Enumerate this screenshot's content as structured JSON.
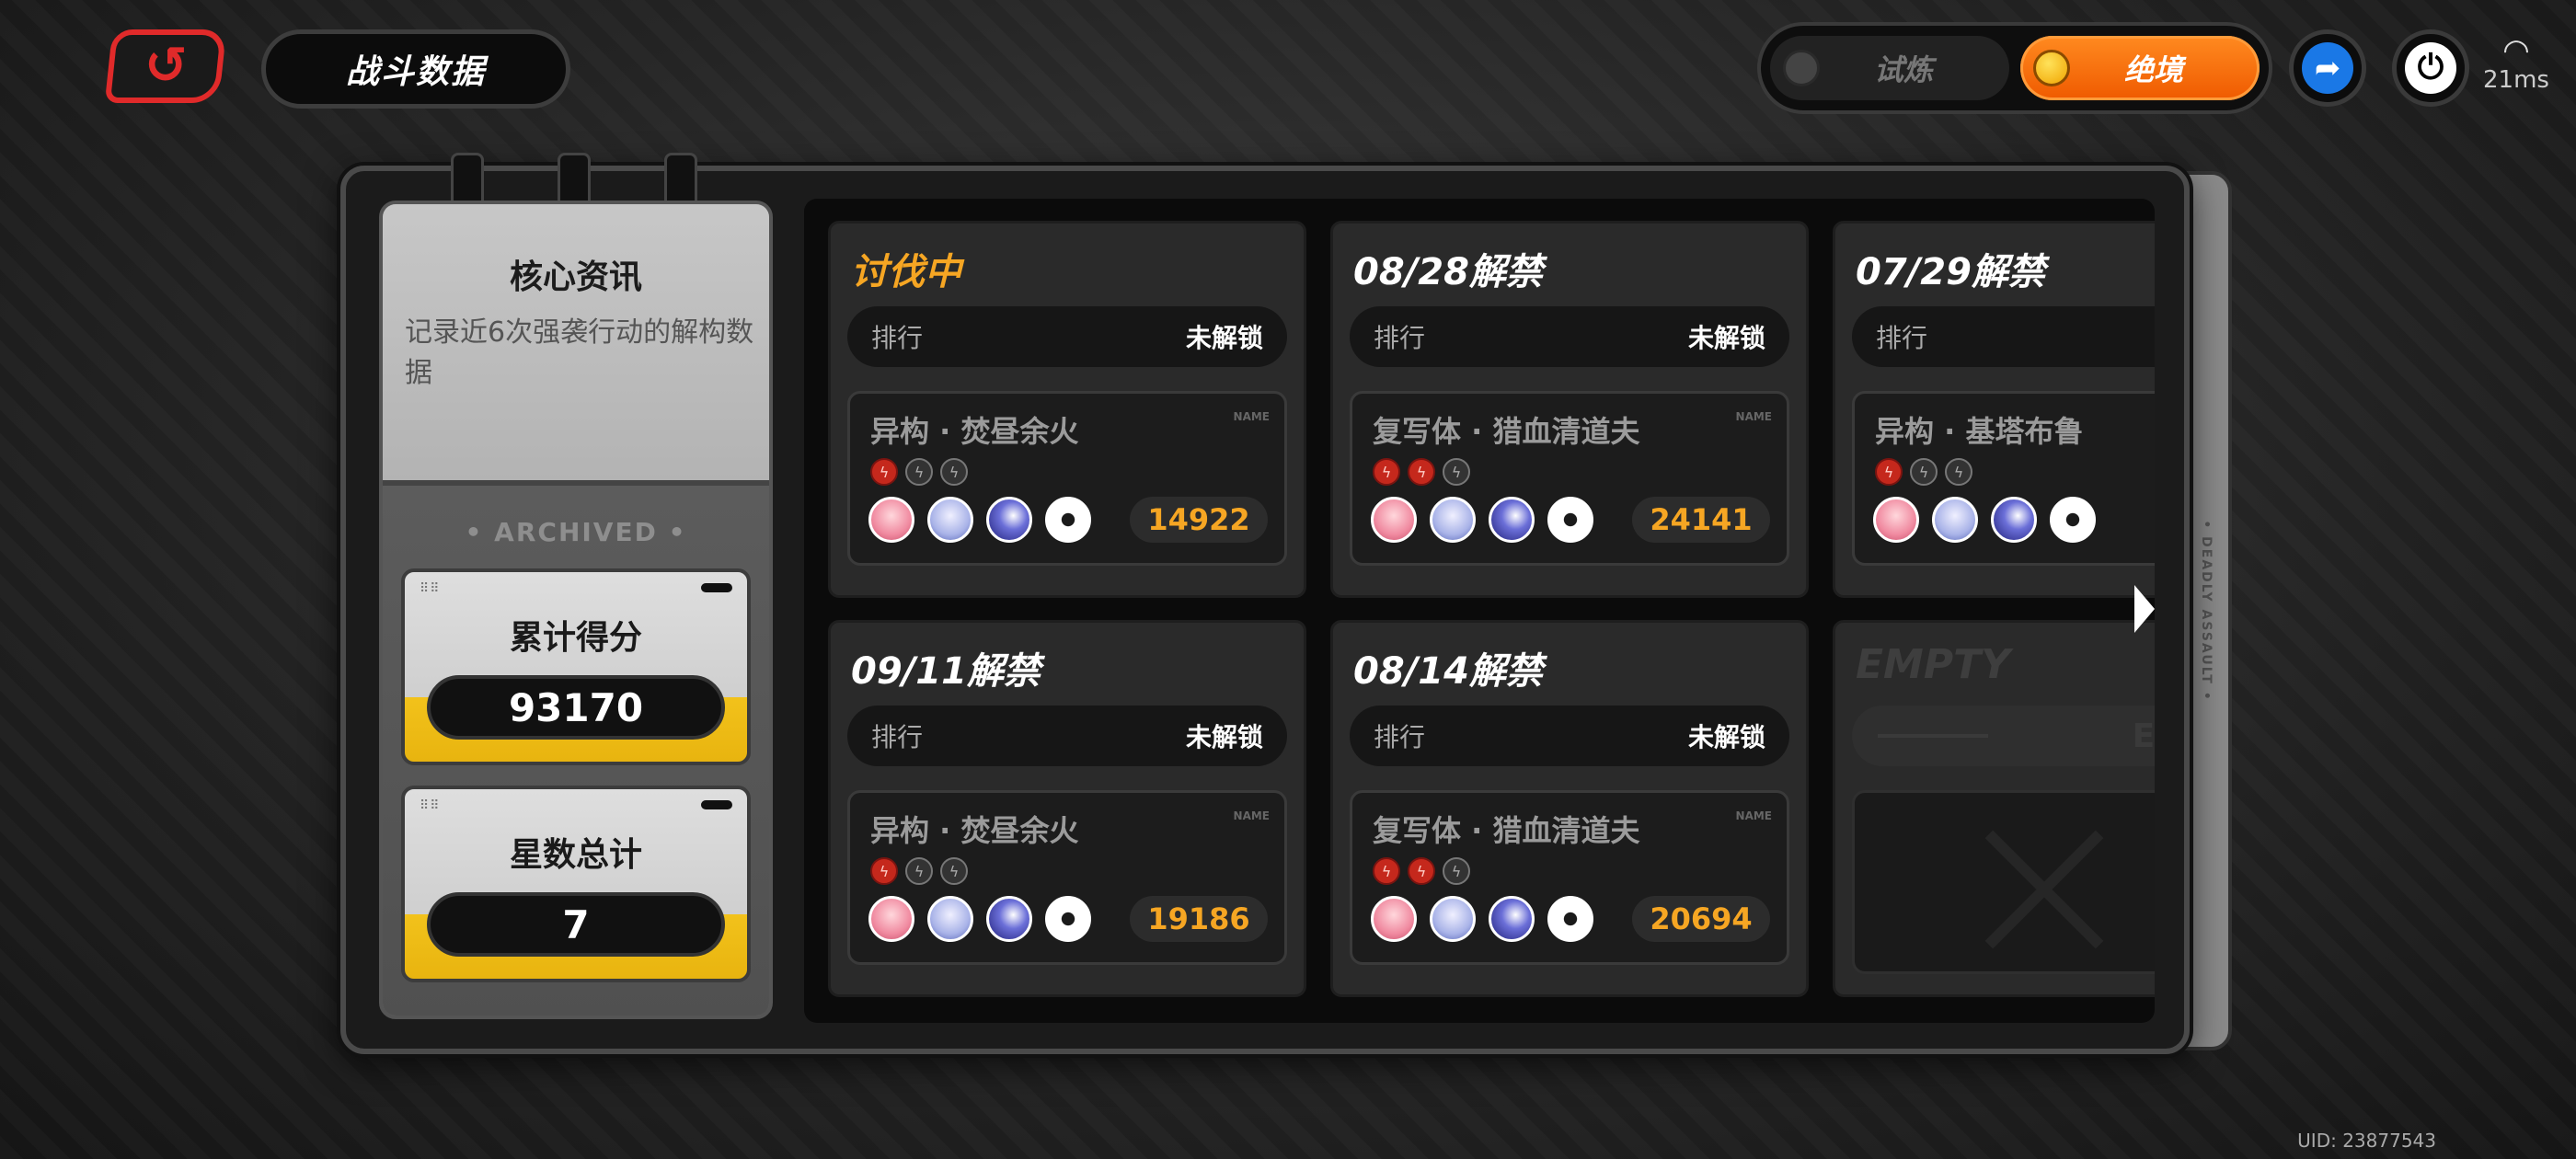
{
  "header": {
    "back_icon": "back-arrow-icon",
    "title": "战斗数据",
    "mode_toggle": {
      "option_off": "试炼",
      "option_on": "绝境",
      "selected": "绝境",
      "accent_color": "#f06a00"
    },
    "share_icon": "share-arrow-icon",
    "power_icon": "power-icon",
    "latency": "21ms",
    "wifi_icon": "wifi-icon"
  },
  "core_info": {
    "title": "核心资讯",
    "description": "记录近6次强袭行动的解构数据",
    "archived_label": "• ARCHIVED •",
    "total_score_label": "累计得分",
    "total_score": "93170",
    "total_stars_label": "星数总计",
    "total_stars": "7"
  },
  "panel_side_label": "• DEADLY ASSAULT •",
  "cards": [
    {
      "status": "讨伐中",
      "active": true,
      "rank_label": "排行",
      "rank_value": "未解锁",
      "boss": "异构 · 焚昼余火",
      "tag": "NAME",
      "elements": [
        "fire",
        "dark",
        "dark"
      ],
      "score": "14922"
    },
    {
      "status": "08/28解禁",
      "active": false,
      "rank_label": "排行",
      "rank_value": "未解锁",
      "boss": "复写体 · 猎血清道夫",
      "tag": "NAME",
      "elements": [
        "fire",
        "fire",
        "dark"
      ],
      "score": "24141"
    },
    {
      "status": "07/29解禁",
      "active": false,
      "rank_label": "排行",
      "rank_value": "",
      "boss": "异构 · 基塔布鲁",
      "tag": "",
      "elements": [
        "fire",
        "dark",
        "dark"
      ],
      "score": ""
    },
    {
      "status": "09/11解禁",
      "active": false,
      "rank_label": "排行",
      "rank_value": "未解锁",
      "boss": "异构 · 焚昼余火",
      "tag": "NAME",
      "elements": [
        "fire",
        "dark",
        "dark"
      ],
      "score": "19186"
    },
    {
      "status": "08/14解禁",
      "active": false,
      "rank_label": "排行",
      "rank_value": "未解锁",
      "boss": "复写体 · 猎血清道夫",
      "tag": "NAME",
      "elements": [
        "fire",
        "fire",
        "dark"
      ],
      "score": "20694"
    }
  ],
  "empty_card": {
    "title": "EMPTY",
    "bar_text": "EMPTY"
  },
  "uid": "UID: 23877543"
}
